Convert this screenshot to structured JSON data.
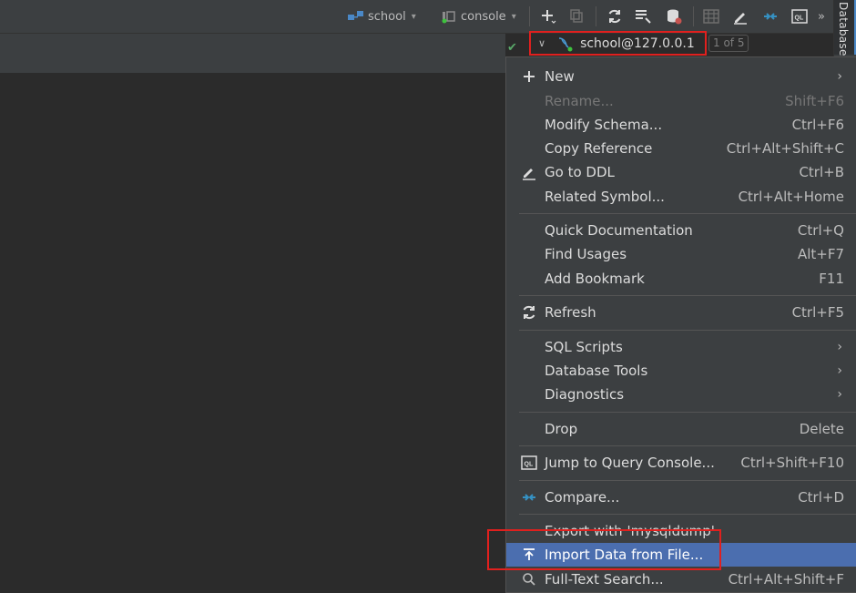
{
  "toolbar": {
    "datasource_label": "school",
    "console_label": "console"
  },
  "side_panel": {
    "label": "Database"
  },
  "breadcrumb": {
    "label": "school@127.0.0.1",
    "count": "1 of 5"
  },
  "menu": {
    "new": {
      "label": "New"
    },
    "rename": {
      "label": "Rename...",
      "shortcut": "Shift+F6"
    },
    "modify_schema": {
      "label": "Modify Schema...",
      "shortcut": "Ctrl+F6"
    },
    "copy_reference": {
      "label": "Copy Reference",
      "shortcut": "Ctrl+Alt+Shift+C"
    },
    "go_to_ddl": {
      "label": "Go to DDL",
      "shortcut": "Ctrl+B"
    },
    "related_symbol": {
      "label": "Related Symbol...",
      "shortcut": "Ctrl+Alt+Home"
    },
    "quick_documentation": {
      "label": "Quick Documentation",
      "shortcut": "Ctrl+Q"
    },
    "find_usages": {
      "label": "Find Usages",
      "shortcut": "Alt+F7"
    },
    "add_bookmark": {
      "label": "Add Bookmark",
      "shortcut": "F11"
    },
    "refresh": {
      "label": "Refresh",
      "shortcut": "Ctrl+F5"
    },
    "sql_scripts": {
      "label": "SQL Scripts"
    },
    "database_tools": {
      "label": "Database Tools"
    },
    "diagnostics": {
      "label": "Diagnostics"
    },
    "drop": {
      "label": "Drop",
      "shortcut": "Delete"
    },
    "jump_to_console": {
      "label": "Jump to Query Console...",
      "shortcut": "Ctrl+Shift+F10"
    },
    "compare": {
      "label": "Compare...",
      "shortcut": "Ctrl+D"
    },
    "export_mysqldump": {
      "label": "Export with 'mysqldump'"
    },
    "import_data": {
      "label": "Import Data from File..."
    },
    "full_text_search": {
      "label": "Full-Text Search...",
      "shortcut": "Ctrl+Alt+Shift+F"
    }
  },
  "colors": {
    "accent": "#4b6eaf",
    "highlight": "#e0201e",
    "ok": "#59a869"
  }
}
